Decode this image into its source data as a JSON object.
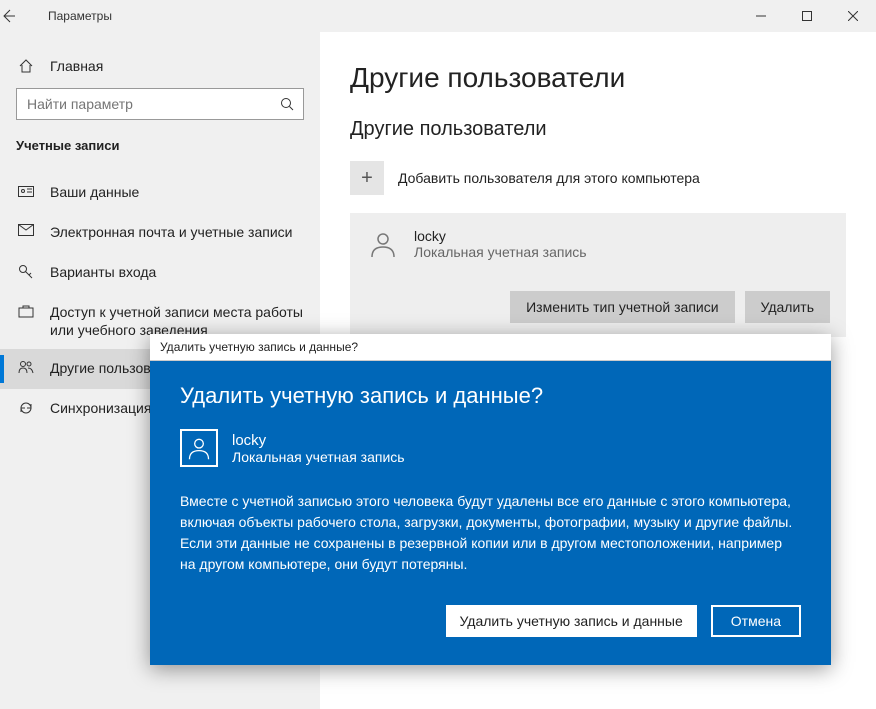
{
  "window": {
    "title": "Параметры"
  },
  "sidebar": {
    "home": "Главная",
    "search_placeholder": "Найти параметр",
    "category": "Учетные записи",
    "items": [
      {
        "label": "Ваши данные"
      },
      {
        "label": "Электронная почта и учетные записи"
      },
      {
        "label": "Варианты входа"
      },
      {
        "label": "Доступ к учетной записи места работы или учебного заведения"
      },
      {
        "label": "Другие пользователи"
      },
      {
        "label": "Синхронизация ваших параметров"
      }
    ]
  },
  "main": {
    "heading": "Другие пользователи",
    "subheading": "Другие пользователи",
    "add_label": "Добавить пользователя для этого компьютера",
    "user": {
      "name": "locky",
      "type": "Локальная учетная запись"
    },
    "buttons": {
      "change_type": "Изменить тип учетной записи",
      "delete": "Удалить"
    }
  },
  "modal": {
    "titlebar": "Удалить учетную запись и данные?",
    "heading": "Удалить учетную запись и данные?",
    "user": {
      "name": "locky",
      "type": "Локальная учетная запись"
    },
    "body": "Вместе с учетной записью этого человека будут удалены все его данные с этого компьютера, включая объекты рабочего стола, загрузки, документы, фотографии, музыку и другие файлы. Если эти данные не сохранены в резервной копии или в другом местоположении, например на другом компьютере, они будут потеряны.",
    "delete_btn": "Удалить учетную запись и данные",
    "cancel_btn": "Отмена"
  }
}
